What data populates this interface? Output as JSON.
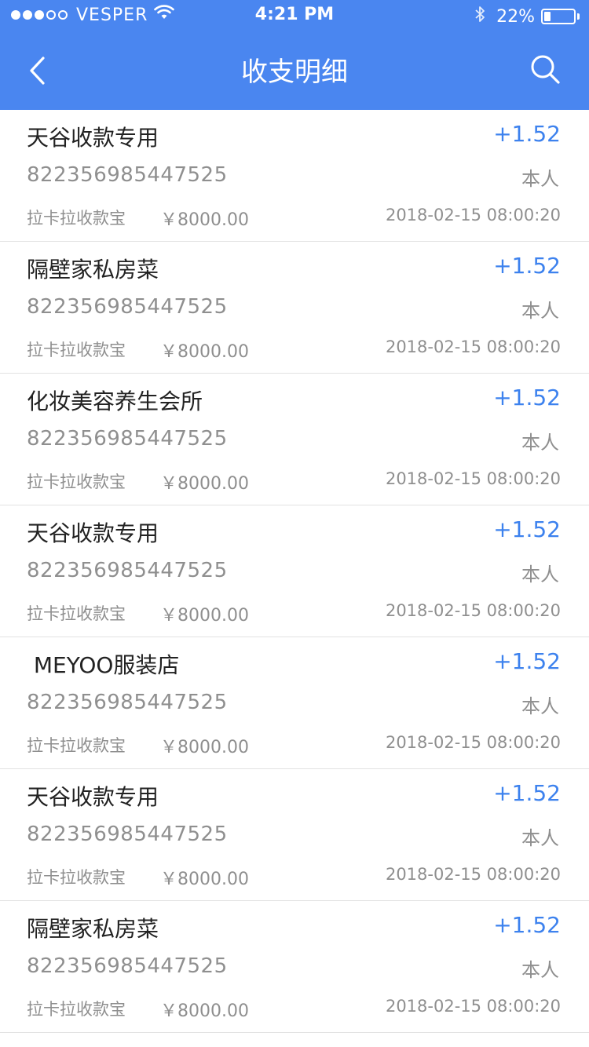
{
  "status_bar": {
    "carrier": "VESPER",
    "time": "4:21 PM",
    "battery_percent": "22%",
    "battery_level": 0.22,
    "signal_filled": 3,
    "signal_total": 5
  },
  "nav": {
    "title": "收支明细",
    "back_icon": "chevron-left-icon",
    "search_icon": "search-icon"
  },
  "colors": {
    "header_bg": "#4a86f0",
    "amount": "#3d82ee",
    "secondary_text": "#8f8f8f",
    "primary_text": "#222222"
  },
  "transactions": [
    {
      "merchant": "天谷收款专用",
      "amount": "+1.52",
      "account": "822356985447525",
      "owner": "本人",
      "channel": "拉卡拉收款宝",
      "total": "￥8000.00",
      "time": "2018-02-15 08:00:20"
    },
    {
      "merchant": "隔壁家私房菜",
      "amount": "+1.52",
      "account": "822356985447525",
      "owner": "本人",
      "channel": "拉卡拉收款宝",
      "total": "￥8000.00",
      "time": "2018-02-15 08:00:20"
    },
    {
      "merchant": "化妆美容养生会所",
      "amount": "+1.52",
      "account": "822356985447525",
      "owner": "本人",
      "channel": "拉卡拉收款宝",
      "total": "￥8000.00",
      "time": "2018-02-15 08:00:20"
    },
    {
      "merchant": "天谷收款专用",
      "amount": "+1.52",
      "account": "822356985447525",
      "owner": "本人",
      "channel": "拉卡拉收款宝",
      "total": "￥8000.00",
      "time": "2018-02-15 08:00:20"
    },
    {
      "merchant": " MEYOO服装店",
      "amount": "+1.52",
      "account": "822356985447525",
      "owner": "本人",
      "channel": "拉卡拉收款宝",
      "total": "￥8000.00",
      "time": "2018-02-15 08:00:20"
    },
    {
      "merchant": "天谷收款专用",
      "amount": "+1.52",
      "account": "822356985447525",
      "owner": "本人",
      "channel": "拉卡拉收款宝",
      "total": "￥8000.00",
      "time": "2018-02-15 08:00:20"
    },
    {
      "merchant": "隔壁家私房菜",
      "amount": "+1.52",
      "account": "822356985447525",
      "owner": "本人",
      "channel": "拉卡拉收款宝",
      "total": "￥8000.00",
      "time": "2018-02-15 08:00:20"
    }
  ]
}
